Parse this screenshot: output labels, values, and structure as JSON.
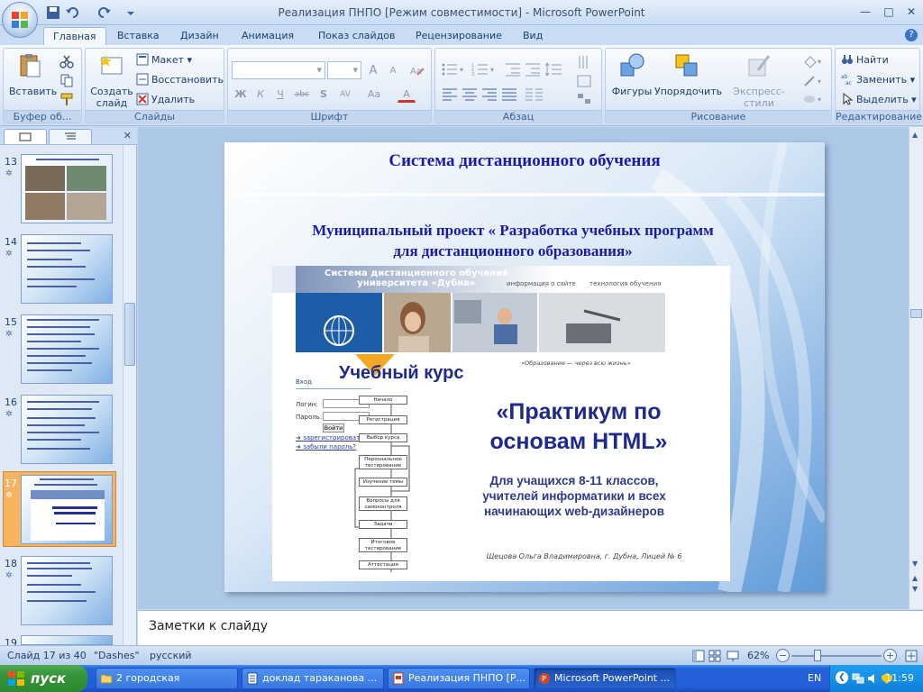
{
  "window": {
    "title": "Реализация ПНПО [Режим совместимости] - Microsoft PowerPoint",
    "min": "—",
    "max": "□",
    "close": "✕"
  },
  "tabs": [
    "Главная",
    "Вставка",
    "Дизайн",
    "Анимация",
    "Показ слайдов",
    "Рецензирование",
    "Вид"
  ],
  "ribbon": {
    "clipboard": {
      "label": "Буфер об...",
      "paste": "Вставить"
    },
    "slides": {
      "label": "Слайды",
      "create": "Создать",
      "create2": "слайд",
      "layout": "Макет",
      "reset": "Восстановить",
      "delete": "Удалить"
    },
    "font": {
      "label": "Шрифт",
      "bold": "Ж",
      "italic": "К",
      "underline": "Ч",
      "strike": "abc",
      "shadow": "S",
      "spacing": "AV",
      "case": "Aa",
      "color": "A",
      "grow": "A",
      "shrink": "A"
    },
    "paragraph": {
      "label": "Абзац"
    },
    "drawing": {
      "label": "Рисование",
      "shapes": "Фигуры",
      "arrange": "Упорядочить",
      "styles": "Экспресс-стили"
    },
    "editing": {
      "label": "Редактирование",
      "find": "Найти",
      "replace": "Заменить",
      "select": "Выделить"
    }
  },
  "thumbnails": [
    {
      "num": "13"
    },
    {
      "num": "14"
    },
    {
      "num": "15"
    },
    {
      "num": "16"
    },
    {
      "num": "17"
    },
    {
      "num": "18"
    },
    {
      "num": "19"
    }
  ],
  "slide": {
    "title": "Система дистанционного  обучения",
    "subtitle1": "Муниципальный проект « Разработка учебных программ",
    "subtitle2": "для дистанционного образования»",
    "embed": {
      "header1": "Система дистанционного обучения",
      "header2": "университета «Дубна»",
      "link1": "информация о сайте",
      "link2": "технология обучения",
      "motto": "«Образование — через всю жизнь»",
      "course_label": "Учебный курс",
      "course_title1": "«Практикум по",
      "course_title2": "основам HTML»",
      "audience1": "Для учащихся 8-11 классов,",
      "audience2": "учителей информатики и всех",
      "audience3": "начинающих web-дизайнеров",
      "author": "Щецова Ольга Владимировна, г. Дубна, Лицей № 6",
      "login_header": "Вход",
      "login_label": "Логин:",
      "password_label": "Пароль:",
      "login_button": "Войти",
      "register_link": "зарегистрироваться",
      "forgot_link": "забыли пароль?",
      "flow": [
        "Начало",
        "Регистрация",
        "Выбор курса",
        "Персональное тестирование",
        "Изучение темы",
        "Вопросы для самоконтроля",
        "Задачи",
        "Итоговое тестирование",
        "Аттестация"
      ]
    }
  },
  "notes": "Заметки к слайду",
  "status": {
    "slide": "Слайд 17 из 40",
    "theme": "\"Dashes\"",
    "language": "русский",
    "zoom": "62%",
    "zoom_minus": "−",
    "zoom_plus": "+"
  },
  "taskbar": {
    "start": "пуск",
    "tasks": [
      "2 городская",
      "доклад тараканова ...",
      "Реализация ПНПО [Р...",
      "Microsoft PowerPoint ..."
    ],
    "lang": "EN",
    "clock": "11:59"
  }
}
